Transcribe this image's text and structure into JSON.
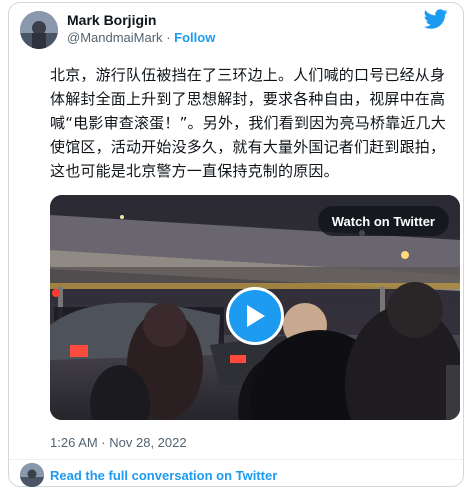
{
  "author": {
    "name": "Mark Borjigin",
    "handle": "@MandmaiMark",
    "separator": "·",
    "follow_label": "Follow"
  },
  "tweet": {
    "text": "北京，游行队伍被挡在了三环边上。人们喊的口号已经从身体解封全面上升到了思想解封，要求各种自由，视屏中在高喊“电影审查滚蛋！”。另外，我们看到因为亮马桥靠近几大使馆区，活动开始没多久，就有大量外国记者们赶到跟拍，这也可能是北京警方一直保持克制的原因。"
  },
  "media": {
    "watch_label": "Watch on Twitter"
  },
  "timestamp": "1:26 AM · Nov 28, 2022",
  "footer": {
    "read_more_label": "Read the full conversation on Twitter"
  },
  "colors": {
    "accent": "#1d9bf0",
    "secondary_text": "#536471",
    "border": "#cfd9de"
  },
  "icons": {
    "brand": "twitter-bird-icon",
    "play": "play-icon"
  }
}
